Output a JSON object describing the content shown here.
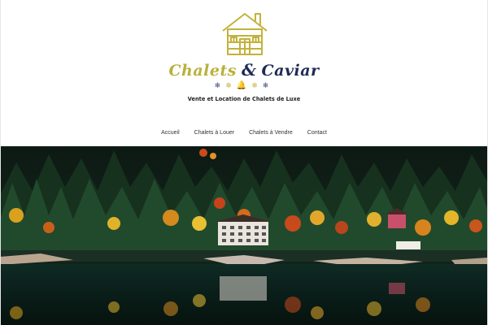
{
  "site": {
    "brand_first": "Chalets",
    "brand_amp": "&",
    "brand_second": "Caviar",
    "tagline": "Vente et Location de Chalets de Luxe",
    "logo_icon": "chalet-cabin-icon",
    "colors": {
      "gold": "#b8b13a",
      "navy": "#1f2a55"
    }
  },
  "decor": {
    "flake": "❄",
    "bell": "🔔"
  },
  "nav": {
    "items": [
      {
        "label": "Accueil"
      },
      {
        "label": "Chalets à Louer"
      },
      {
        "label": "Chalets à Vendre"
      },
      {
        "label": "Contact"
      }
    ]
  },
  "hero": {
    "image": "autumn-lake-chalet-photo"
  }
}
